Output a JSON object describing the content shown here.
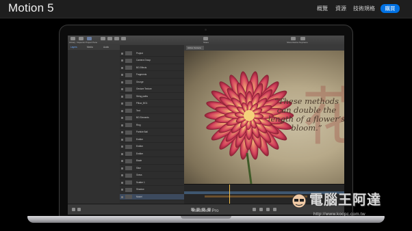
{
  "nav": {
    "title": "Motion 5",
    "links": [
      "概覽",
      "資源",
      "技術規格"
    ],
    "buy_label": "購買"
  },
  "laptop": {
    "model": "MacBook Pro"
  },
  "app": {
    "toolbar_left": [
      "Library",
      "Inspector",
      "Project Pane"
    ],
    "toolbar_center": [
      "Share"
    ],
    "toolbar_right": [
      "Show Retina",
      "Keyframe"
    ],
    "panel_tabs": [
      "Layers",
      "Media",
      "Audio"
    ],
    "camera_select": "Active Camera",
    "layers": [
      "Project",
      "Camera Group",
      "BG Effects",
      "Fragments",
      "Grunge",
      "Gesture Texture",
      "String paths",
      "Pillow_BG1",
      "Text",
      "BG Elements",
      "Ring",
      "Particle Ball",
      "Emitter",
      "Emitter",
      "Emitter",
      "Blade",
      "Slice",
      "Grass",
      "Scatter 1",
      "Shadow",
      "Model"
    ],
    "canvas": {
      "quote": "“These methods can double the length of a flower’s bloom.”",
      "kanji": "花"
    }
  },
  "watermark": {
    "title": "電腦王阿達",
    "url": "http://www.kocpc.com.tw"
  },
  "colors": {
    "accent": "#0071e3",
    "page_bg": "#000000",
    "nav_bg": "#1e1e1e"
  }
}
